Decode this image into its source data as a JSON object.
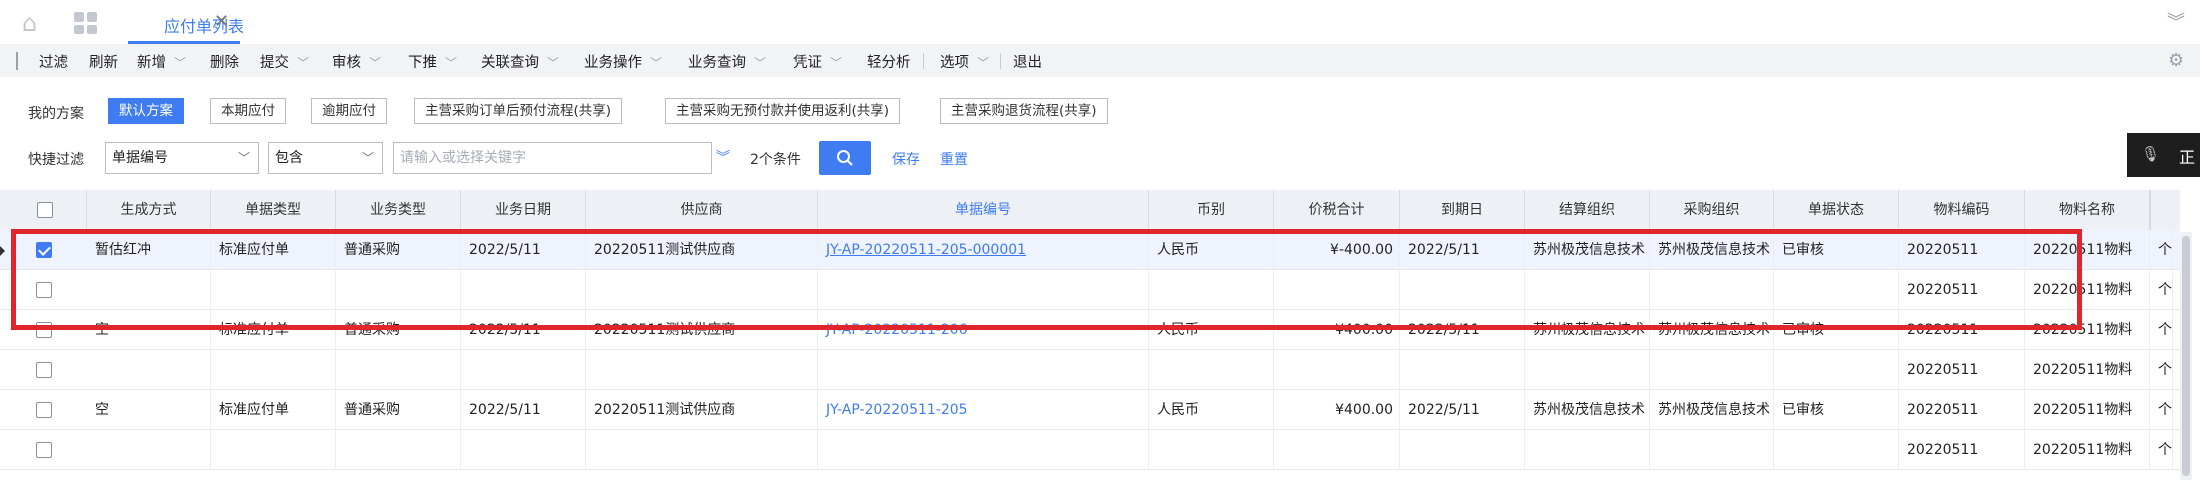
{
  "tabs": {
    "home_icon": "home-icon",
    "apps_icon": "grid-icon",
    "active_label": "应付单列表",
    "close_glyph": "✕",
    "collapse_glyph": "︾"
  },
  "toolbar": {
    "items": [
      {
        "label": "过滤",
        "menu": false
      },
      {
        "label": "刷新",
        "menu": false
      },
      {
        "label": "新增",
        "menu": true
      },
      {
        "label": "删除",
        "menu": false
      },
      {
        "label": "提交",
        "menu": true
      },
      {
        "label": "审核",
        "menu": true
      },
      {
        "label": "下推",
        "menu": true
      },
      {
        "label": "关联查询",
        "menu": true
      },
      {
        "label": "业务操作",
        "menu": true
      },
      {
        "label": "业务查询",
        "menu": true
      },
      {
        "label": "凭证",
        "menu": true
      },
      {
        "label": "轻分析",
        "menu": false
      },
      {
        "label": "选项",
        "menu": true
      },
      {
        "label": "退出",
        "menu": false
      }
    ],
    "chevron": "﹀",
    "settings_icon": "gear-icon"
  },
  "schemes": {
    "label": "我的方案",
    "items": [
      "默认方案",
      "本期应付",
      "逾期应付",
      "主营采购订单后预付流程(共享)",
      "主营采购无预付款并使用返利(共享)",
      "主营采购退货流程(共享)"
    ],
    "active_index": 0
  },
  "quick_filter": {
    "label": "快捷过滤",
    "field": "单据编号",
    "operator": "包含",
    "keyword_placeholder": "请输入或选择关键字",
    "expand_glyph": "︾",
    "condition_count": "2个条件",
    "save_label": "保存",
    "reset_label": "重置"
  },
  "overlay": {
    "text": "正"
  },
  "grid": {
    "columns": [
      "生成方式",
      "单据类型",
      "业务类型",
      "业务日期",
      "供应商",
      "单据编号",
      "币别",
      "价税合计",
      "到期日",
      "结算组织",
      "采购组织",
      "单据状态",
      "物料编码",
      "物料名称",
      ""
    ],
    "rows": [
      {
        "checked": true,
        "cells": [
          "暂估红冲",
          "标准应付单",
          "普通采购",
          "2022/5/11",
          "20220511测试供应商",
          "JY-AP-20220511-205-000001",
          "人民币",
          "¥-400.00",
          "2022/5/11",
          "苏州极茂信息技术",
          "苏州极茂信息技术",
          "已审核",
          "20220511",
          "20220511物料",
          "个"
        ]
      },
      {
        "checked": false,
        "cells": [
          "",
          "",
          "",
          "",
          "",
          "",
          "",
          "",
          "",
          "",
          "",
          "",
          "20220511",
          "20220511物料",
          "个"
        ]
      },
      {
        "checked": false,
        "cells": [
          "空",
          "标准应付单",
          "普通采购",
          "2022/5/11",
          "20220511测试供应商",
          "JY-AP-20220511-206",
          "人民币",
          "¥400.00",
          "2022/5/11",
          "苏州极茂信息技术",
          "苏州极茂信息技术",
          "已审核",
          "20220511",
          "20220511物料",
          "个"
        ]
      },
      {
        "checked": false,
        "cells": [
          "",
          "",
          "",
          "",
          "",
          "",
          "",
          "",
          "",
          "",
          "",
          "",
          "20220511",
          "20220511物料",
          "个"
        ]
      },
      {
        "checked": false,
        "cells": [
          "空",
          "标准应付单",
          "普通采购",
          "2022/5/11",
          "20220511测试供应商",
          "JY-AP-20220511-205",
          "人民币",
          "¥400.00",
          "2022/5/11",
          "苏州极茂信息技术",
          "苏州极茂信息技术",
          "已审核",
          "20220511",
          "20220511物料",
          "个"
        ]
      },
      {
        "checked": false,
        "cells": [
          "",
          "",
          "",
          "",
          "",
          "",
          "",
          "",
          "",
          "",
          "",
          "",
          "20220511",
          "20220511物料",
          "个"
        ]
      }
    ]
  },
  "colors": {
    "accent": "#3f7cf1",
    "highlight": "#e0262c"
  }
}
